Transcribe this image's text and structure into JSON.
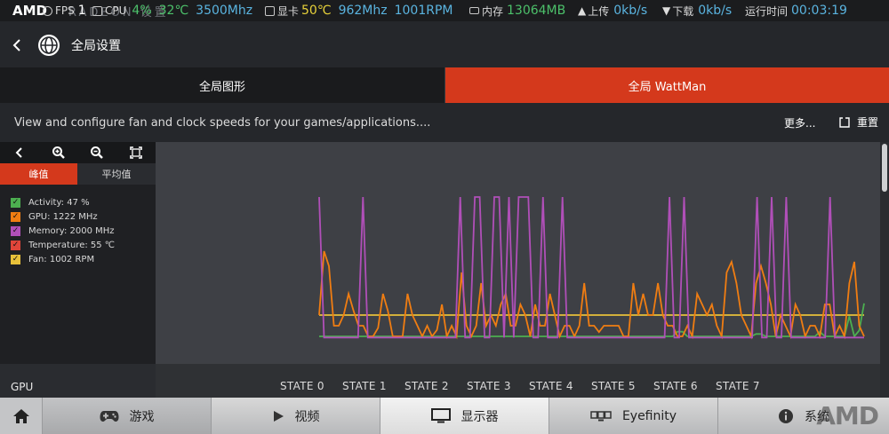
{
  "overlay": {
    "brand": "AMD",
    "brand_sub": "RADEON 设置",
    "fps_label": "FPS",
    "fps_value": "1",
    "cpu_label": "CPU",
    "cpu_usage": "4%",
    "cpu_temp": "32℃",
    "cpu_clock": "3500Mhz",
    "gpu_label": "显卡",
    "gpu_temp": "50℃",
    "gpu_clock": "962Mhz",
    "gpu_fan": "1001RPM",
    "mem_label": "内存",
    "mem_value": "13064MB",
    "up_label": "上传",
    "up_value": "0kb/s",
    "down_label": "下载",
    "down_value": "0kb/s",
    "runtime_label": "运行时间",
    "runtime_value": "00:03:19"
  },
  "header": {
    "title": "全局设置"
  },
  "tabs": [
    {
      "label": "全局图形",
      "active": false
    },
    {
      "label": "全局 WattMan",
      "active": true
    }
  ],
  "description": "View and configure fan and clock speeds for your games/applications....",
  "actions": {
    "more": "更多...",
    "reset": "重置"
  },
  "modes": {
    "peak": "峰值",
    "average": "平均值"
  },
  "legend": [
    {
      "label": "Activity: 47 %",
      "color": "#4caf50",
      "checked": true
    },
    {
      "label": "GPU: 1222 MHz",
      "color": "#f07d12",
      "checked": true
    },
    {
      "label": "Memory: 2000 MHz",
      "color": "#b04fb8",
      "checked": true
    },
    {
      "label": "Temperature: 55 ℃",
      "color": "#e0453a",
      "checked": true
    },
    {
      "label": "Fan: 1002 RPM",
      "color": "#e8c13a",
      "checked": true
    }
  ],
  "chart_data": {
    "type": "line",
    "series": [
      {
        "name": "Activity",
        "color": "#4caf50",
        "values": [
          0,
          0,
          0,
          0,
          0,
          0,
          0,
          0,
          0,
          0,
          0,
          0,
          0,
          0,
          0,
          0,
          0,
          0,
          0,
          0,
          0,
          0,
          0,
          0,
          0,
          0,
          0,
          0,
          0,
          0,
          0,
          0,
          0,
          0,
          0,
          0,
          0,
          0,
          0,
          0,
          0,
          0,
          0,
          0,
          0,
          0,
          0,
          0,
          0,
          0,
          0,
          0,
          0,
          0,
          0,
          0,
          0,
          0,
          0,
          0,
          0,
          0,
          0,
          0,
          0,
          0,
          0,
          0,
          0,
          0,
          0,
          0,
          0,
          4,
          4,
          0,
          0,
          0,
          0,
          0,
          0,
          0,
          0,
          0,
          0,
          0,
          0,
          0,
          0,
          2,
          2,
          0,
          0,
          0,
          0,
          0,
          0,
          0,
          0,
          0,
          0,
          0,
          4,
          0,
          0,
          0,
          0,
          0,
          17,
          0,
          5,
          28
        ]
      },
      {
        "name": "GPU",
        "color": "#f07d12",
        "values": [
          10,
          40,
          33,
          5,
          5,
          10,
          20,
          12,
          5,
          5,
          0,
          0,
          4,
          20,
          12,
          0,
          0,
          0,
          20,
          10,
          5,
          0,
          5,
          0,
          3,
          15,
          0,
          5,
          0,
          30,
          5,
          0,
          5,
          25,
          5,
          10,
          5,
          15,
          20,
          5,
          5,
          15,
          10,
          0,
          15,
          5,
          5,
          20,
          10,
          0,
          5,
          5,
          0,
          5,
          25,
          5,
          5,
          2,
          5,
          5,
          5,
          5,
          0,
          0,
          25,
          10,
          20,
          10,
          10,
          25,
          10,
          5,
          5,
          0,
          0,
          5,
          0,
          20,
          15,
          10,
          15,
          5,
          0,
          30,
          35,
          25,
          10,
          5,
          0,
          25,
          33,
          25,
          15,
          0,
          10,
          5,
          0,
          15,
          10,
          0,
          5,
          5,
          0,
          15,
          15,
          0,
          5,
          0,
          25,
          35,
          5,
          0
        ]
      },
      {
        "name": "Memory",
        "color": "#b04fb8",
        "values": [
          60,
          10,
          10,
          10,
          10,
          10,
          10,
          10,
          10,
          60,
          10,
          10,
          10,
          10,
          10,
          10,
          10,
          10,
          10,
          10,
          10,
          10,
          10,
          10,
          10,
          10,
          10,
          10,
          10,
          60,
          10,
          10,
          60,
          60,
          10,
          10,
          60,
          60,
          10,
          60,
          10,
          60,
          60,
          60,
          10,
          10,
          60,
          10,
          10,
          10,
          60,
          10,
          10,
          10,
          10,
          10,
          10,
          10,
          10,
          10,
          10,
          10,
          10,
          10,
          10,
          10,
          10,
          10,
          10,
          10,
          10,
          10,
          60,
          10,
          10,
          60,
          10,
          10,
          10,
          10,
          10,
          10,
          10,
          10,
          10,
          10,
          10,
          10,
          10,
          10,
          60,
          10,
          10,
          60,
          10,
          10,
          60,
          10,
          10,
          10,
          10,
          10,
          10,
          10,
          10,
          60,
          10,
          10,
          10,
          10,
          10,
          10,
          10
        ]
      },
      {
        "name": "Temperature",
        "color": "#e0453a",
        "values": [
          55,
          55,
          54.5,
          54.5,
          55,
          54.5,
          54.5,
          55,
          54.5,
          54.5,
          54.5,
          54.5,
          54.5,
          54.5,
          54.5,
          54.5,
          54.5,
          54.5,
          54.5,
          54.5,
          54.5,
          54.5,
          54.5,
          54.5,
          54.5,
          54.5,
          54.5,
          54.5,
          54.5,
          54.5,
          54.5,
          54.5,
          54.5,
          54.5,
          54.5,
          54.5,
          54.5,
          54.5,
          54.5,
          54.5,
          54.5,
          54.5,
          54.5,
          54.5,
          54.5,
          54.5,
          54.5,
          54.5,
          54.5,
          54.5,
          54.5,
          54.5,
          54.5,
          54.5,
          54.5,
          54.5,
          54.5,
          54.5,
          54.5,
          54.5,
          54.5,
          54.5,
          54.5,
          54.5,
          54.5,
          54.5,
          54.5,
          54.5,
          54.5,
          54.5,
          54.5,
          54.5,
          54.5,
          54.5,
          54.5,
          54.5,
          54.5,
          54.5,
          54.5,
          54.5,
          54.5,
          54.5,
          54.5,
          54.5,
          54.5,
          54.5,
          54.5,
          54.5,
          54.5,
          54.5,
          54.5,
          54.5,
          54.5,
          54.5,
          54.5,
          54.5,
          54.5,
          54.5,
          54.5,
          54.5,
          54.5,
          54.5,
          54.5,
          54.5,
          54.5,
          54.5,
          54.5,
          54.5,
          54.5,
          54.5,
          54.5,
          54.5,
          54.5,
          54.5,
          54
        ]
      },
      {
        "name": "Fan",
        "color": "#e8c13a",
        "values": [
          1001,
          1001,
          1001,
          1001,
          1001,
          1001,
          1001,
          1001,
          1001,
          1001,
          1001,
          1001,
          1001,
          1001,
          1001,
          1001,
          1001,
          1001,
          1001,
          1001,
          1001,
          1001,
          1001,
          1001,
          1001,
          1001,
          1001,
          1001,
          1001,
          1001,
          1001,
          1001,
          1001,
          1001,
          1001,
          1001,
          1001,
          1001,
          1001,
          1001,
          1001,
          1001,
          1001,
          1001,
          1001,
          1001,
          1001,
          1001,
          1001,
          1001,
          1001,
          1001,
          1001,
          1001,
          1001,
          1001,
          1001,
          1001,
          1001,
          1001,
          1001,
          1001,
          1001,
          1001,
          1001,
          1001,
          1001,
          1001,
          1001,
          1001,
          1001,
          1001,
          1001,
          1001,
          1001,
          1001,
          1001,
          1001,
          1001,
          1001,
          1001,
          1001,
          1001,
          1001,
          1001,
          1001,
          1001,
          1001,
          1001,
          1001,
          1001,
          1001,
          1001,
          1001,
          1001,
          1001,
          1001,
          1001,
          1001,
          1001,
          1001,
          1001,
          1001,
          1001,
          1001,
          1001,
          1001,
          1001,
          1001,
          1001,
          1001,
          1001,
          1001
        ]
      }
    ],
    "xlabel": "",
    "ylabel": "",
    "grid": false
  },
  "states": {
    "row_label": "GPU",
    "labels": [
      "STATE 0",
      "STATE 1",
      "STATE 2",
      "STATE 3",
      "STATE 4",
      "STATE 5",
      "STATE 6",
      "STATE 7"
    ]
  },
  "nav": {
    "games": "游戏",
    "video": "视频",
    "display": "显示器",
    "eyefinity": "Eyefinity",
    "system": "系统",
    "watermark": "AMD"
  }
}
